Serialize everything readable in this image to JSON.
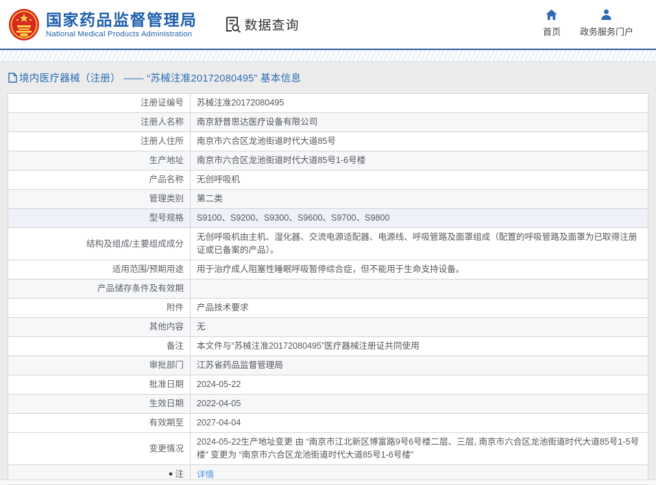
{
  "header": {
    "org_cn": "国家药品监督管理局",
    "org_en": "National Medical Products Administration",
    "section_title": "数据查询",
    "nav": [
      {
        "label": "首页",
        "icon": "home-icon"
      },
      {
        "label": "政务服务门户",
        "icon": "user-icon"
      }
    ]
  },
  "title": {
    "text": "境内医疗器械（注册） ——  “苏械注准20172080495” 基本信息"
  },
  "table": {
    "rows": [
      {
        "label": "注册证编号",
        "value": "苏械注准20172080495",
        "shade": "none"
      },
      {
        "label": "注册人名称",
        "value": "南京舒普思达医疗设备有限公司",
        "shade": "gray"
      },
      {
        "label": "注册人住所",
        "value": "南京市六合区龙池街道时代大道85号",
        "shade": "none"
      },
      {
        "label": "生产地址",
        "value": "南京市六合区龙池街道时代大道85号1-6号楼",
        "shade": "gray"
      },
      {
        "label": "产品名称",
        "value": "无创呼吸机",
        "shade": "none"
      },
      {
        "label": "管理类别",
        "value": "第二类",
        "shade": "gray"
      },
      {
        "label": "型号规格",
        "value": "S9100、S9200、S9300、S9600、S9700、S9800",
        "shade": "blue"
      },
      {
        "label": "结构及组成/主要组成成分",
        "value": "无创呼吸机由主机、湿化器、交流电源适配器、电源线、呼吸管路及面罩组成（配置的呼吸管路及面罩为已取得注册证或已备案的产品）。",
        "shade": "none"
      },
      {
        "label": "适用范围/预期用途",
        "value": "用于治疗成人阻塞性睡眠呼吸暂停综合症，但不能用于生命支持设备。",
        "shade": "none"
      },
      {
        "label": "产品储存条件及有效期",
        "value": "",
        "shade": "gray"
      },
      {
        "label": "附件",
        "value": "产品技术要求",
        "shade": "none"
      },
      {
        "label": "其他内容",
        "value": "无",
        "shade": "gray"
      },
      {
        "label": "备注",
        "value": "本文件与“苏械注准20172080495”医疗器械注册证共同使用",
        "shade": "none"
      },
      {
        "label": "审批部门",
        "value": "江苏省药品监督管理局",
        "shade": "gray"
      },
      {
        "label": "批准日期",
        "value": "2024-05-22",
        "shade": "none"
      },
      {
        "label": "生效日期",
        "value": "2022-04-05",
        "shade": "gray"
      },
      {
        "label": "有效期至",
        "value": "2027-04-04",
        "shade": "none"
      },
      {
        "label": "变更情况",
        "value": "2024-05-22生产地址变更 由 “南京市江北新区博富路9号6号楼二层、三层, 南京市六合区龙池街道时代大道85号1-5号楼” 变更为 “南京市六合区龙池街道时代大道85号1-6号楼”",
        "shade": "none"
      },
      {
        "label": "注",
        "value": "详情",
        "shade": "gray",
        "label_icon": "note-pin-icon",
        "value_is_link": true
      }
    ]
  },
  "colors": {
    "brand_blue": "#1e5fac",
    "header_line": "#2b5d9e",
    "title_blue": "#2c6bb3",
    "link_blue": "#4e95d9",
    "row_gray": "#f6f7f8",
    "row_blue": "#eef1f8",
    "border": "#d4d4d4",
    "emblem_red": "#d5281e",
    "emblem_gold": "#ffd04a"
  }
}
